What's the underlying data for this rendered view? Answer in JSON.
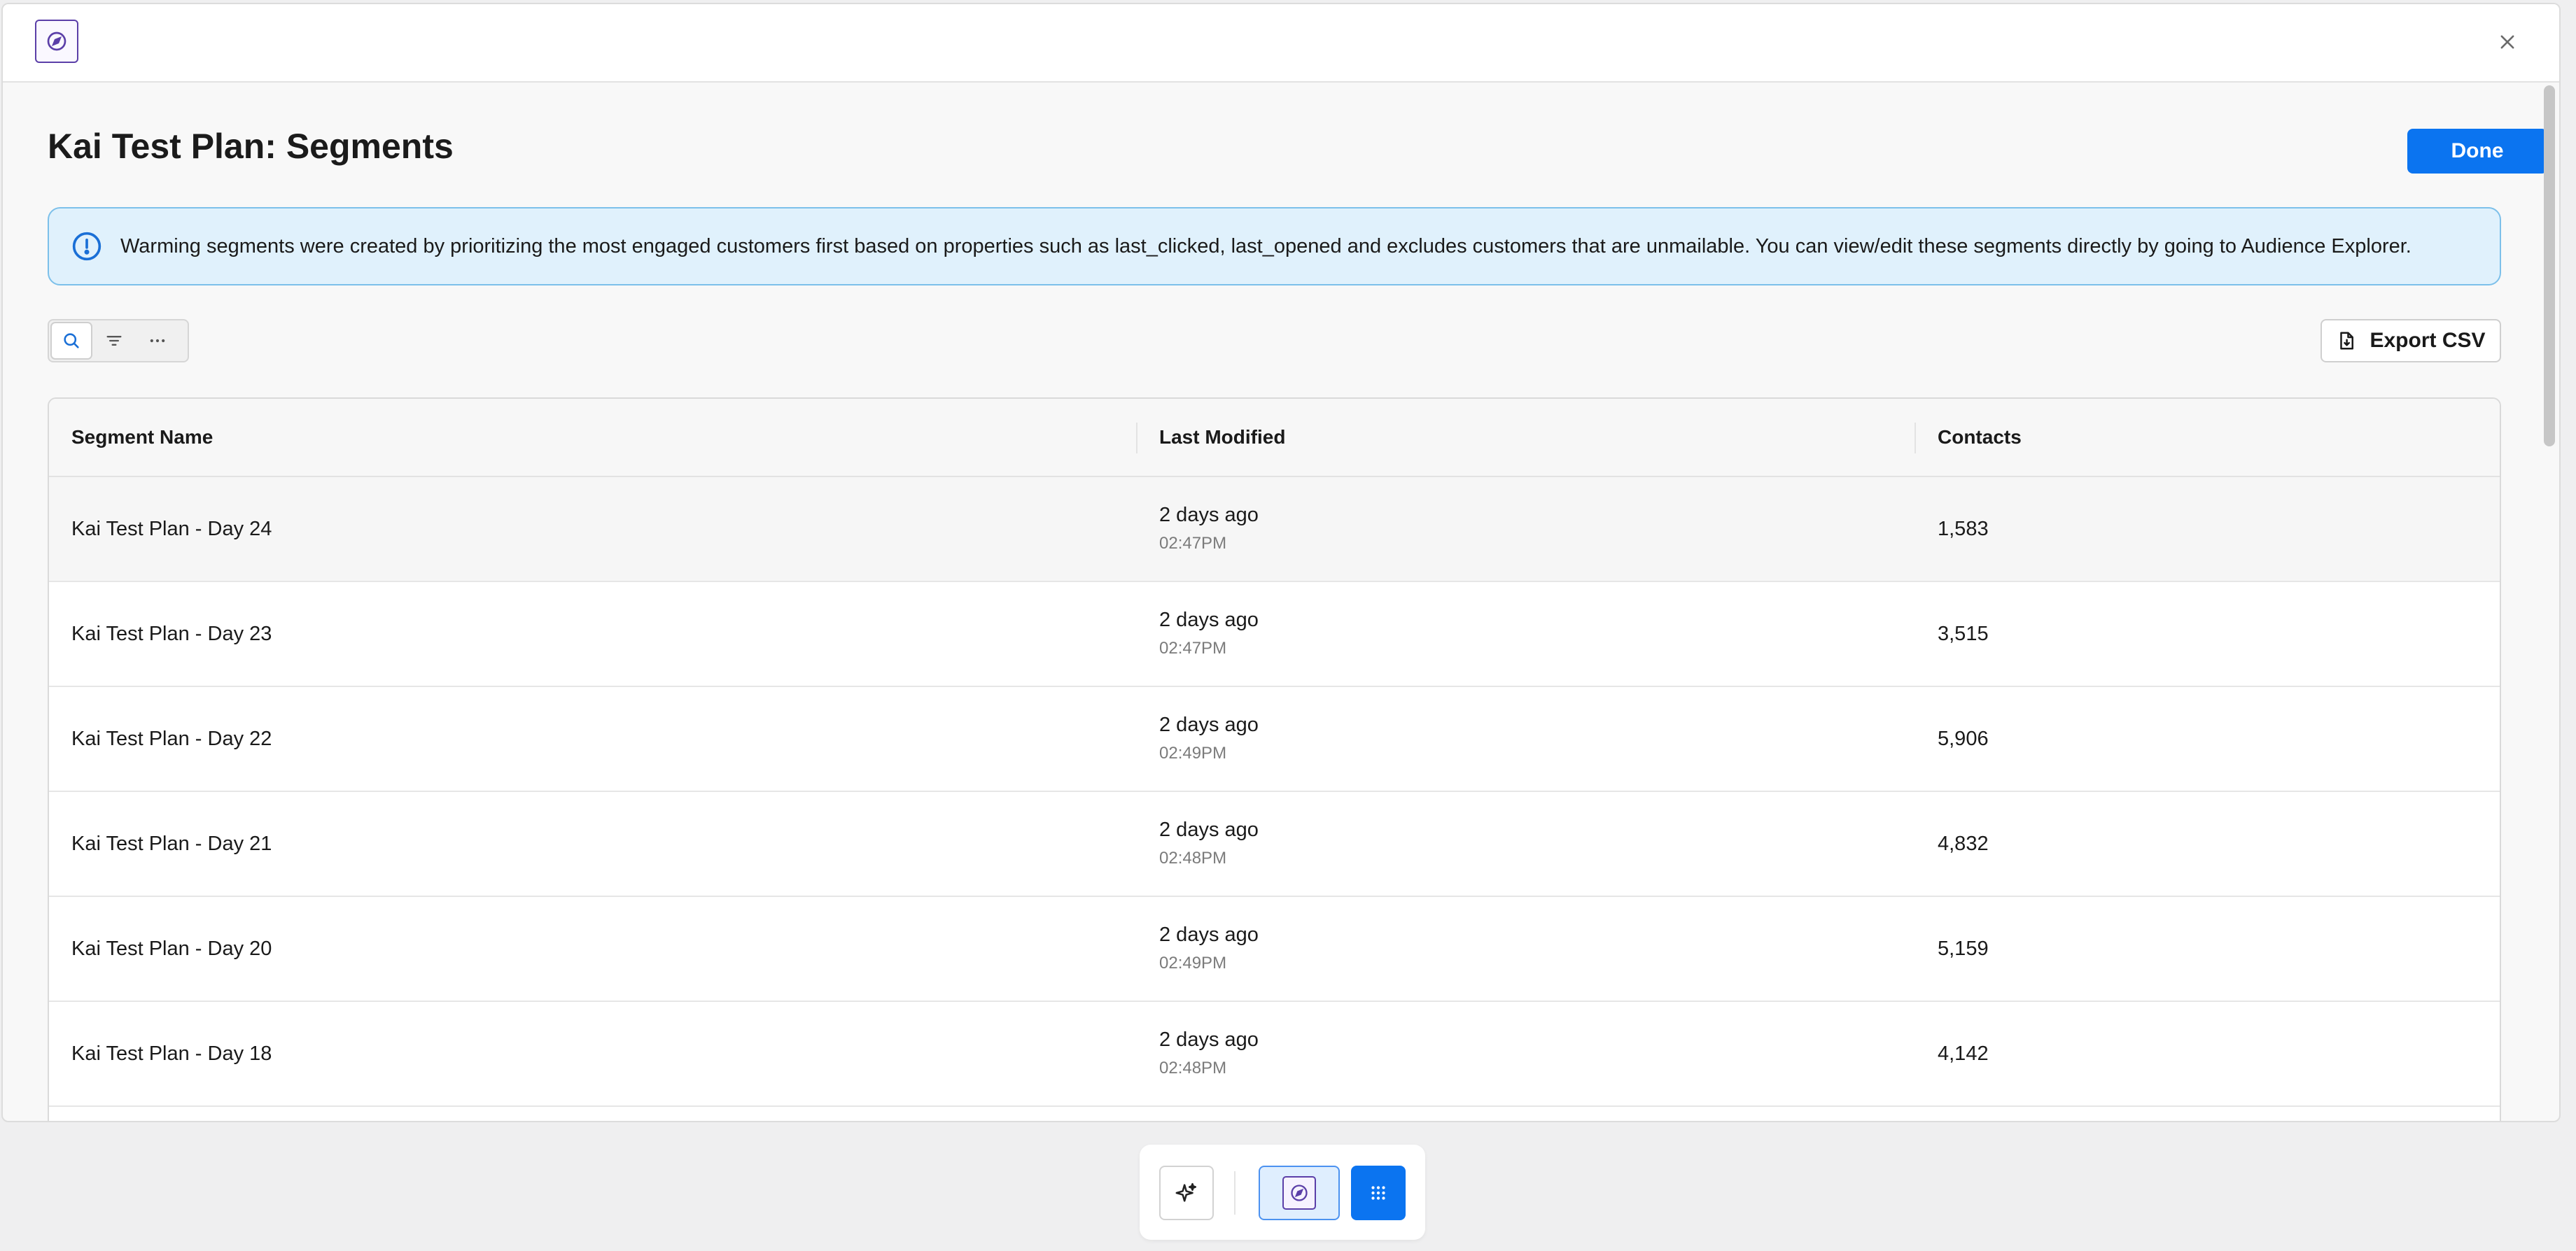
{
  "modal": {
    "title": "Kai Test Plan: Segments",
    "done_label": "Done"
  },
  "banner": {
    "text": "Warming segments were created by prioritizing the most engaged customers first based on properties such as last_clicked, last_opened and excludes customers that are unmailable. You can view/edit these segments directly by going to Audience Explorer."
  },
  "toolbar": {
    "export_label": "Export CSV"
  },
  "table": {
    "headers": [
      "Segment Name",
      "Last Modified",
      "Contacts"
    ],
    "rows": [
      {
        "name": "Kai Test Plan - Day 24",
        "modified": "2 days ago",
        "time": "02:47PM",
        "contacts": "1,583"
      },
      {
        "name": "Kai Test Plan - Day 23",
        "modified": "2 days ago",
        "time": "02:47PM",
        "contacts": "3,515"
      },
      {
        "name": "Kai Test Plan - Day 22",
        "modified": "2 days ago",
        "time": "02:49PM",
        "contacts": "5,906"
      },
      {
        "name": "Kai Test Plan - Day 21",
        "modified": "2 days ago",
        "time": "02:48PM",
        "contacts": "4,832"
      },
      {
        "name": "Kai Test Plan - Day 20",
        "modified": "2 days ago",
        "time": "02:49PM",
        "contacts": "5,159"
      },
      {
        "name": "Kai Test Plan - Day 18",
        "modified": "2 days ago",
        "time": "02:48PM",
        "contacts": "4,142"
      }
    ]
  },
  "icons": {
    "app": "compass-icon",
    "close": "close-icon",
    "info": "info-icon",
    "search": "search-icon",
    "filter": "filter-icon",
    "more": "more-horizontal-icon",
    "export": "file-download-icon",
    "ai": "sparkle-icon",
    "apps": "grid-icon"
  },
  "colors": {
    "primary": "#0b74f0",
    "banner_bg": "#e0f1fc",
    "banner_border": "#7cc0ea",
    "brand_purple": "#5b3fa8"
  }
}
